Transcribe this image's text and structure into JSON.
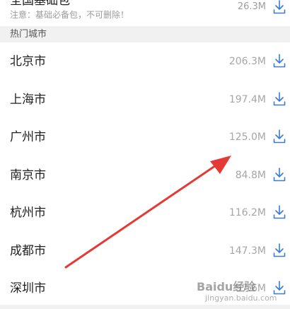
{
  "top_package": {
    "title": "全国基础包",
    "note": "注意：基础必备包，不可删除！",
    "size": "26.3M"
  },
  "section": {
    "title": "热门城市"
  },
  "cities": [
    {
      "name": "北京市",
      "size": "206.3M"
    },
    {
      "name": "上海市",
      "size": "197.4M"
    },
    {
      "name": "广州市",
      "size": "125.0M"
    },
    {
      "name": "南京市",
      "size": "84.8M"
    },
    {
      "name": "杭州市",
      "size": "116.2M"
    },
    {
      "name": "成都市",
      "size": "147.3M"
    },
    {
      "name": "深圳市",
      "size": "97.6M"
    }
  ],
  "icons": {
    "download": "download-icon",
    "annotation": "red-arrow"
  },
  "colors": {
    "accent": "#3a7bd5",
    "arrow": "#e53935"
  },
  "watermark": {
    "brand": "Baidu经验",
    "sub": "jingyan.baidu.com"
  }
}
